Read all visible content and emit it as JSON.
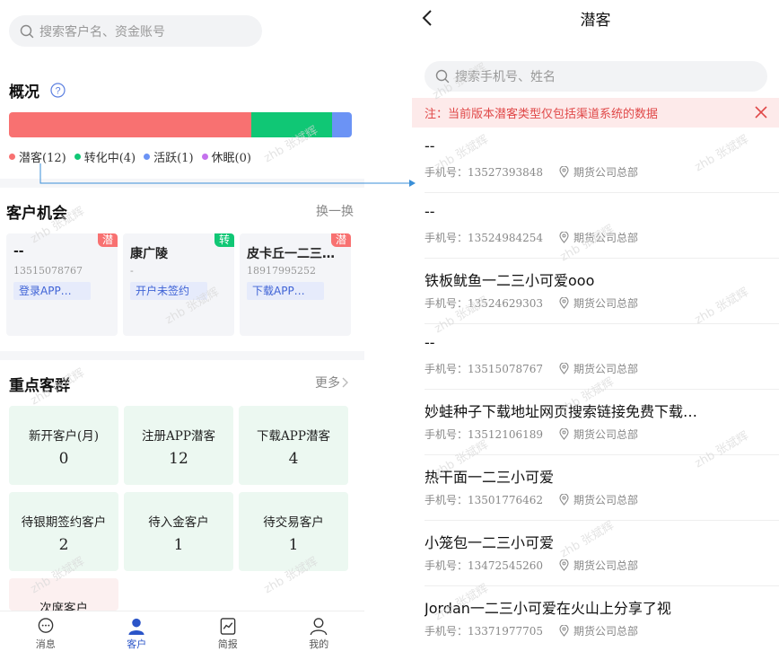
{
  "left": {
    "search": {
      "placeholder": "搜索客户名、资金账号",
      "icon": "search-icon"
    },
    "overview": {
      "title": "概况",
      "help_icon": "question-circle-icon",
      "segments": [
        {
          "label": "潜客(12)",
          "value": 12,
          "color": "#f87171"
        },
        {
          "label": "转化中(4)",
          "value": 4,
          "color": "#10c775"
        },
        {
          "label": "活跃(1)",
          "value": 1,
          "color": "#6b93f5"
        },
        {
          "label": "休眠(0)",
          "value": 0,
          "color": "#c471ed"
        }
      ]
    },
    "opportunities": {
      "title": "客户机会",
      "more": "换一换",
      "cards": [
        {
          "badge": "潜",
          "badge_color": "#f87171",
          "name": "--",
          "phone": "13515078767",
          "tag": "登录APP…"
        },
        {
          "badge": "转",
          "badge_color": "#10c775",
          "name": "康广陵",
          "phone": "-",
          "tag": "开户未签约"
        },
        {
          "badge": "潜",
          "badge_color": "#f87171",
          "name": "皮卡丘一二三…",
          "phone": "18917995252",
          "tag": "下载APP…"
        }
      ]
    },
    "groups": {
      "title": "重点客群",
      "more": "更多",
      "items": [
        {
          "label": "新开客户(月)",
          "value": "0"
        },
        {
          "label": "注册APP潜客",
          "value": "12"
        },
        {
          "label": "下载APP潜客",
          "value": "4"
        },
        {
          "label": "待银期签约客户",
          "value": "2"
        },
        {
          "label": "待入金客户",
          "value": "1"
        },
        {
          "label": "待交易客户",
          "value": "1"
        },
        {
          "label": "次席客户",
          "value": ""
        }
      ]
    },
    "tabbar": [
      {
        "label": "消息",
        "icon": "chat-bubble-icon"
      },
      {
        "label": "客户",
        "icon": "user-filled-icon"
      },
      {
        "label": "简报",
        "icon": "chart-report-icon"
      },
      {
        "label": "我的",
        "icon": "user-outline-icon"
      }
    ]
  },
  "right": {
    "title": "潜客",
    "search": {
      "placeholder": "搜索手机号、姓名"
    },
    "notice": "注：当前版本潜客类型仅包括渠道系统的数据",
    "phone_prefix": "手机号：",
    "rows": [
      {
        "name": "--",
        "phone": "13527393848",
        "location": "期货公司总部"
      },
      {
        "name": "--",
        "phone": "13524984254",
        "location": "期货公司总部"
      },
      {
        "name": "铁板鱿鱼一二三小可爱ooo",
        "phone": "13524629303",
        "location": "期货公司总部"
      },
      {
        "name": "--",
        "phone": "13515078767",
        "location": "期货公司总部"
      },
      {
        "name": "妙蛙种子下载地址网页搜索链接免费下载…",
        "phone": "13512106189",
        "location": "期货公司总部"
      },
      {
        "name": "热干面一二三小可爱",
        "phone": "13501776462",
        "location": "期货公司总部"
      },
      {
        "name": "小笼包一二三小可爱",
        "phone": "13472545260",
        "location": "期货公司总部"
      },
      {
        "name": "Jordan一二三小可爱在火山上分享了视",
        "phone": "13371977705",
        "location": "期货公司总部"
      }
    ]
  },
  "watermark": "zhb 张斌辉"
}
